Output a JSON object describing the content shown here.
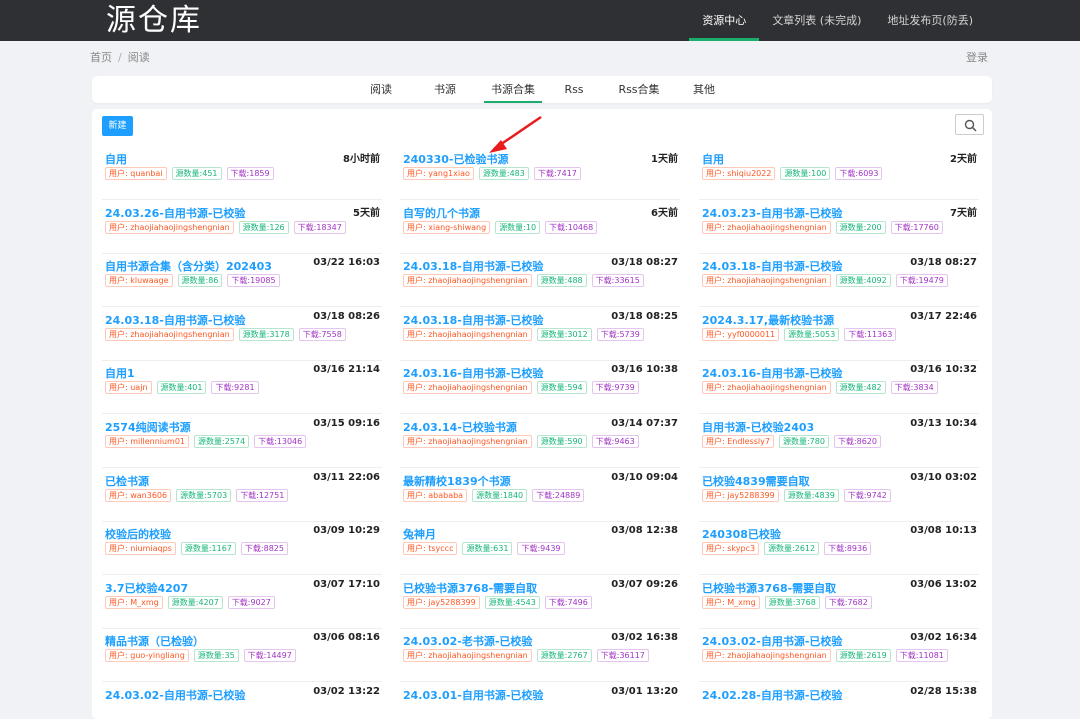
{
  "header": {
    "logo": "源仓库",
    "nav": [
      "资源中心",
      "文章列表 (未完成)",
      "地址发布页(防丢)"
    ]
  },
  "breadcrumb": {
    "home": "首页",
    "sep": "/",
    "current": "阅读"
  },
  "login": "登录",
  "tabs": [
    "阅读",
    "书源",
    "书源合集",
    "Rss",
    "Rss合集",
    "其他"
  ],
  "actions": {
    "new_button": "新建",
    "search_icon": "search-icon"
  },
  "colors": {
    "accent": "#1e9fff",
    "nav_active": "#1aad6b",
    "user_tag": "#ff5722",
    "count_tag": "#16b777",
    "download_tag": "#a233c6"
  },
  "items": [
    {
      "title": "自用",
      "time": "8小时前",
      "user": "用户: quanbai",
      "count": "源数量:451",
      "downloads": "下载:1859"
    },
    {
      "title": "240330-已检验书源",
      "time": "1天前",
      "user": "用户: yang1xiao",
      "count": "源数量:483",
      "downloads": "下载:7417"
    },
    {
      "title": "自用",
      "time": "2天前",
      "user": "用户: shiqiu2022",
      "count": "源数量:100",
      "downloads": "下载:6093"
    },
    {
      "title": "24.03.26-自用书源-已校验",
      "time": "5天前",
      "user": "用户: zhaojiahaojingshengnian",
      "count": "源数量:126",
      "downloads": "下载:18347"
    },
    {
      "title": "自写的几个书源",
      "time": "6天前",
      "user": "用户: xiang-shiwang",
      "count": "源数量:10",
      "downloads": "下载:10468"
    },
    {
      "title": "24.03.23-自用书源-已校验",
      "time": "7天前",
      "user": "用户: zhaojiahaojingshengnian",
      "count": "源数量:200",
      "downloads": "下载:17760"
    },
    {
      "title": "自用书源合集（含分类）202403",
      "time": "03/22 16:03",
      "user": "用户: kluwaage",
      "count": "源数量:86",
      "downloads": "下载:19085"
    },
    {
      "title": "24.03.18-自用书源-已校验",
      "time": "03/18 08:27",
      "user": "用户: zhaojiahaojingshengnian",
      "count": "源数量:488",
      "downloads": "下载:33615"
    },
    {
      "title": "24.03.18-自用书源-已校验",
      "time": "03/18 08:27",
      "user": "用户: zhaojiahaojingshengnian",
      "count": "源数量:4092",
      "downloads": "下载:19479"
    },
    {
      "title": "24.03.18-自用书源-已校验",
      "time": "03/18 08:26",
      "user": "用户: zhaojiahaojingshengnian",
      "count": "源数量:3178",
      "downloads": "下载:7558"
    },
    {
      "title": "24.03.18-自用书源-已校验",
      "time": "03/18 08:25",
      "user": "用户: zhaojiahaojingshengnian",
      "count": "源数量:3012",
      "downloads": "下载:5739"
    },
    {
      "title": "2024.3.17,最新校验书源",
      "time": "03/17 22:46",
      "user": "用户: yyf0000011",
      "count": "源数量:5053",
      "downloads": "下载:11363"
    },
    {
      "title": "自用1",
      "time": "03/16 21:14",
      "user": "用户: uajn",
      "count": "源数量:401",
      "downloads": "下载:9281"
    },
    {
      "title": "24.03.16-自用书源-已校验",
      "time": "03/16 10:38",
      "user": "用户: zhaojiahaojingshengnian",
      "count": "源数量:594",
      "downloads": "下载:9739"
    },
    {
      "title": "24.03.16-自用书源-已校验",
      "time": "03/16 10:32",
      "user": "用户: zhaojiahaojingshengnian",
      "count": "源数量:482",
      "downloads": "下载:3834"
    },
    {
      "title": "2574纯阅读书源",
      "time": "03/15 09:16",
      "user": "用户: millennium01",
      "count": "源数量:2574",
      "downloads": "下载:13046"
    },
    {
      "title": "24.03.14-已校验书源",
      "time": "03/14 07:37",
      "user": "用户: zhaojiahaojingshengnian",
      "count": "源数量:590",
      "downloads": "下载:9463"
    },
    {
      "title": "自用书源-已校验2403",
      "time": "03/13 10:34",
      "user": "用户: Endlessly7",
      "count": "源数量:780",
      "downloads": "下载:8620"
    },
    {
      "title": "已检书源",
      "time": "03/11 22:06",
      "user": "用户: wan3606",
      "count": "源数量:5703",
      "downloads": "下载:12751"
    },
    {
      "title": "最新精校1839个书源",
      "time": "03/10 09:04",
      "user": "用户: abababa",
      "count": "源数量:1840",
      "downloads": "下载:24889"
    },
    {
      "title": "已校验4839需要自取",
      "time": "03/10 03:02",
      "user": "用户: jay5288399",
      "count": "源数量:4839",
      "downloads": "下载:9742"
    },
    {
      "title": "校验后的校验",
      "time": "03/09 10:29",
      "user": "用户: niumiaqps",
      "count": "源数量:1167",
      "downloads": "下载:8825"
    },
    {
      "title": "兔神月",
      "time": "03/08 12:38",
      "user": "用户: tsyccc",
      "count": "源数量:631",
      "downloads": "下载:9439"
    },
    {
      "title": "240308已校验",
      "time": "03/08 10:13",
      "user": "用户: skypc3",
      "count": "源数量:2612",
      "downloads": "下载:8936"
    },
    {
      "title": "3.7已校验4207",
      "time": "03/07 17:10",
      "user": "用户: M_xmg",
      "count": "源数量:4207",
      "downloads": "下载:9027"
    },
    {
      "title": "已校验书源3768-需要自取",
      "time": "03/07 09:26",
      "user": "用户: jay5288399",
      "count": "源数量:4543",
      "downloads": "下载:7496"
    },
    {
      "title": "已校验书源3768-需要自取",
      "time": "03/06 13:02",
      "user": "用户: M_xmg",
      "count": "源数量:3768",
      "downloads": "下载:7682"
    },
    {
      "title": "精品书源（已检验）",
      "time": "03/06 08:16",
      "user": "用户: guo-yingliang",
      "count": "源数量:35",
      "downloads": "下载:14497"
    },
    {
      "title": "24.03.02-老书源-已校验",
      "time": "03/02 16:38",
      "user": "用户: zhaojiahaojingshengnian",
      "count": "源数量:2767",
      "downloads": "下载:36117"
    },
    {
      "title": "24.03.02-自用书源-已校验",
      "time": "03/02 16:34",
      "user": "用户: zhaojiahaojingshengnian",
      "count": "源数量:2619",
      "downloads": "下载:11081"
    },
    {
      "title": "24.03.02-自用书源-已校验",
      "time": "03/02 13:22",
      "user": "",
      "count": "",
      "downloads": ""
    },
    {
      "title": "24.03.01-自用书源-已校验",
      "time": "03/01 13:20",
      "user": "",
      "count": "",
      "downloads": ""
    },
    {
      "title": "24.02.28-自用书源-已校验",
      "time": "02/28 15:38",
      "user": "",
      "count": "",
      "downloads": ""
    }
  ]
}
